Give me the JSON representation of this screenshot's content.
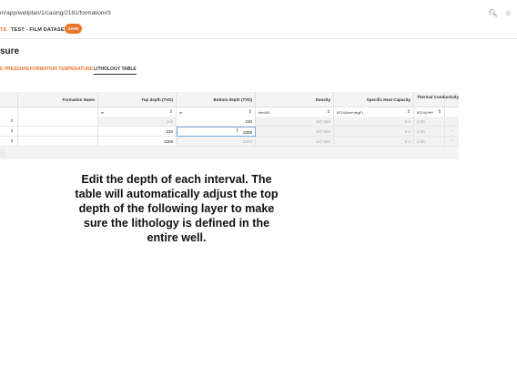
{
  "browser": {
    "url": "m/app/wellplan/1/casing/2181/formation#3",
    "icons": [
      "zoom-icon",
      "star-icon"
    ]
  },
  "topbar": {
    "crumb_tail": "TS",
    "dataset_label": "TEST - FILM DATASET",
    "save_label": "SAVE"
  },
  "page": {
    "title": "sure"
  },
  "tabs": [
    {
      "label": "E PRESSURE",
      "active": false
    },
    {
      "label": "FORMATION TEMPERATURE",
      "active": false
    },
    {
      "label": "LITHOLOGY TABLE",
      "active": true
    }
  ],
  "table": {
    "columns": [
      {
        "label": "Formation Name",
        "unit": ""
      },
      {
        "label": "Top depth (TVD)",
        "unit": "m"
      },
      {
        "label": "Bottom depth (TVD)",
        "unit": "m"
      },
      {
        "label": "Density",
        "unit": "lbm/ft3"
      },
      {
        "label": "Specific Heat Capacity",
        "unit": "BTU/(lbm*degF)"
      },
      {
        "label": "Thermal Conductivity",
        "unit": "BTU/(h*ft*"
      }
    ],
    "rows": [
      {
        "formation_name": "",
        "top_depth": "225",
        "bottom_depth": "230",
        "density": "187.653",
        "specific_heat": "0.4",
        "thermal_conductivity": "0.96"
      },
      {
        "formation_name": "",
        "top_depth": "230",
        "bottom_depth": "3309",
        "density": "187.653",
        "specific_heat": "0.4",
        "thermal_conductivity": "0.96"
      },
      {
        "formation_name": "",
        "top_depth": "3309",
        "bottom_depth": "3320",
        "density": "187.653",
        "specific_heat": "0.4",
        "thermal_conductivity": "0.96"
      }
    ]
  },
  "caption": "Edit the depth of each interval. The table will automatically adjust the top depth of the following layer to make sure the lithology is defined in the entire well."
}
